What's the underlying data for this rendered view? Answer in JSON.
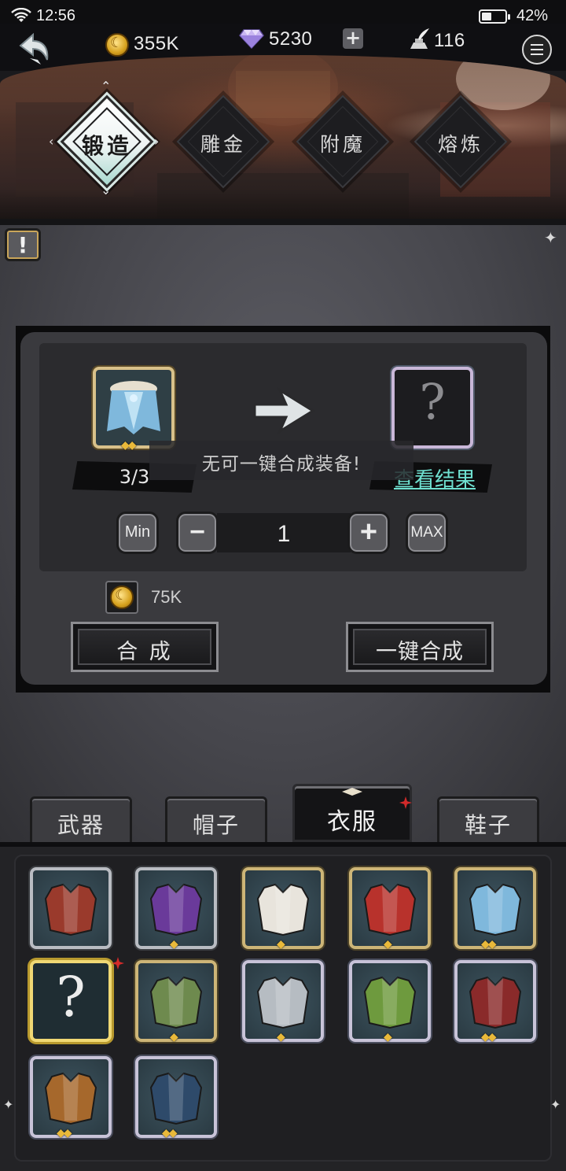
{
  "status_bar": {
    "time": "12:56",
    "battery_pct": "42%",
    "battery_level": 0.42
  },
  "currency": {
    "gold": "355K",
    "gems": "5230",
    "gem_add": "+",
    "quill": "116"
  },
  "forge_tabs": [
    {
      "label": "锻造",
      "active": true
    },
    {
      "label": "雕金",
      "active": false
    },
    {
      "label": "附魔",
      "active": false
    },
    {
      "label": "熔炼",
      "active": false
    }
  ],
  "info_button": {
    "label": "!"
  },
  "craft": {
    "source_count": "3/3",
    "source_stars": "◆◆",
    "result_placeholder": "?",
    "view_result": "查看结果",
    "toast": "无可一键合成装备!",
    "min_label": "Min",
    "minus_label": "−",
    "quantity": "1",
    "plus_label": "+",
    "max_label": "MAX",
    "cost": "75K",
    "craft_button": "合 成",
    "auto_craft_button": "一键合成"
  },
  "category_tabs": [
    {
      "label": "武器",
      "active": false
    },
    {
      "label": "帽子",
      "active": false
    },
    {
      "label": "衣服",
      "active": true,
      "badge": true
    },
    {
      "label": "鞋子",
      "active": false
    }
  ],
  "items": [
    {
      "name": "fur-trimmed-red-coat",
      "stars": "",
      "frame": "gray"
    },
    {
      "name": "purple-cloak",
      "stars": "◆",
      "frame": "gray"
    },
    {
      "name": "white-dress",
      "stars": "◆",
      "frame": "gold"
    },
    {
      "name": "red-military-jacket",
      "stars": "◆",
      "frame": "gold"
    },
    {
      "name": "blue-fur-cape",
      "stars": "◆◆",
      "frame": "gold"
    },
    {
      "name": "unknown-item",
      "stars": "",
      "frame": "selected",
      "question": "?"
    },
    {
      "name": "green-ruffled-shirt",
      "stars": "◆",
      "frame": "gold"
    },
    {
      "name": "steel-chest-armor",
      "stars": "◆",
      "frame": "rainbow"
    },
    {
      "name": "leaf-feather-vest",
      "stars": "◆",
      "frame": "rainbow"
    },
    {
      "name": "crimson-robe",
      "stars": "◆◆",
      "frame": "rainbow"
    },
    {
      "name": "brown-trench-coat",
      "stars": "◆◆",
      "frame": "rainbow"
    },
    {
      "name": "blue-gold-armor",
      "stars": "◆◆",
      "frame": "rainbow"
    }
  ]
}
